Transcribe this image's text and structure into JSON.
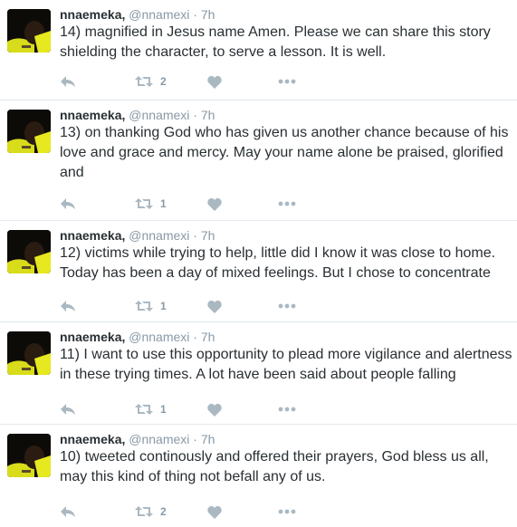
{
  "tweets": [
    {
      "name": "nnaemeka,",
      "handle": "@nnamexi",
      "separator": "·",
      "time": "7h",
      "text": "14) magnified in Jesus name Amen. Please we can share this story shielding the character, to serve a  lesson. It is well.",
      "retweets": "2",
      "icons": [
        "reply-icon",
        "retweet-icon",
        "like-icon",
        "more-icon"
      ]
    },
    {
      "name": "nnaemeka,",
      "handle": "@nnamexi",
      "separator": "·",
      "time": "7h",
      "text": "13) on thanking God who has given us another chance because of his love and grace and mercy. May your name alone be praised, glorified and",
      "retweets": "1",
      "icons": [
        "reply-icon",
        "retweet-icon",
        "like-icon",
        "more-icon"
      ]
    },
    {
      "name": "nnaemeka,",
      "handle": "@nnamexi",
      "separator": "·",
      "time": "7h",
      "text": "12) victims while trying to help, little did I know it was close to home. Today has been a day of mixed feelings. But I chose to concentrate",
      "retweets": "1",
      "icons": [
        "reply-icon",
        "retweet-icon",
        "like-icon",
        "more-icon"
      ]
    },
    {
      "name": "nnaemeka,",
      "handle": "@nnamexi",
      "separator": "·",
      "time": "7h",
      "text": "11) I want to use this opportunity to plead more vigilance and alertness in these trying times. A lot have been said about people falling",
      "retweets": "1",
      "icons": [
        "reply-icon",
        "retweet-icon",
        "like-icon",
        "more-icon"
      ]
    },
    {
      "name": "nnaemeka,",
      "handle": "@nnamexi",
      "separator": "·",
      "time": "7h",
      "text": "10) tweeted continously and offered their prayers, God bless us all, may this kind of thing not befall any of us.",
      "retweets": "2",
      "icons": [
        "reply-icon",
        "retweet-icon",
        "like-icon",
        "more-icon"
      ]
    }
  ],
  "colors": {
    "name": "#292f33",
    "meta": "#8899a6",
    "icon": "#aab8c2",
    "divider": "#e1e8ed"
  }
}
